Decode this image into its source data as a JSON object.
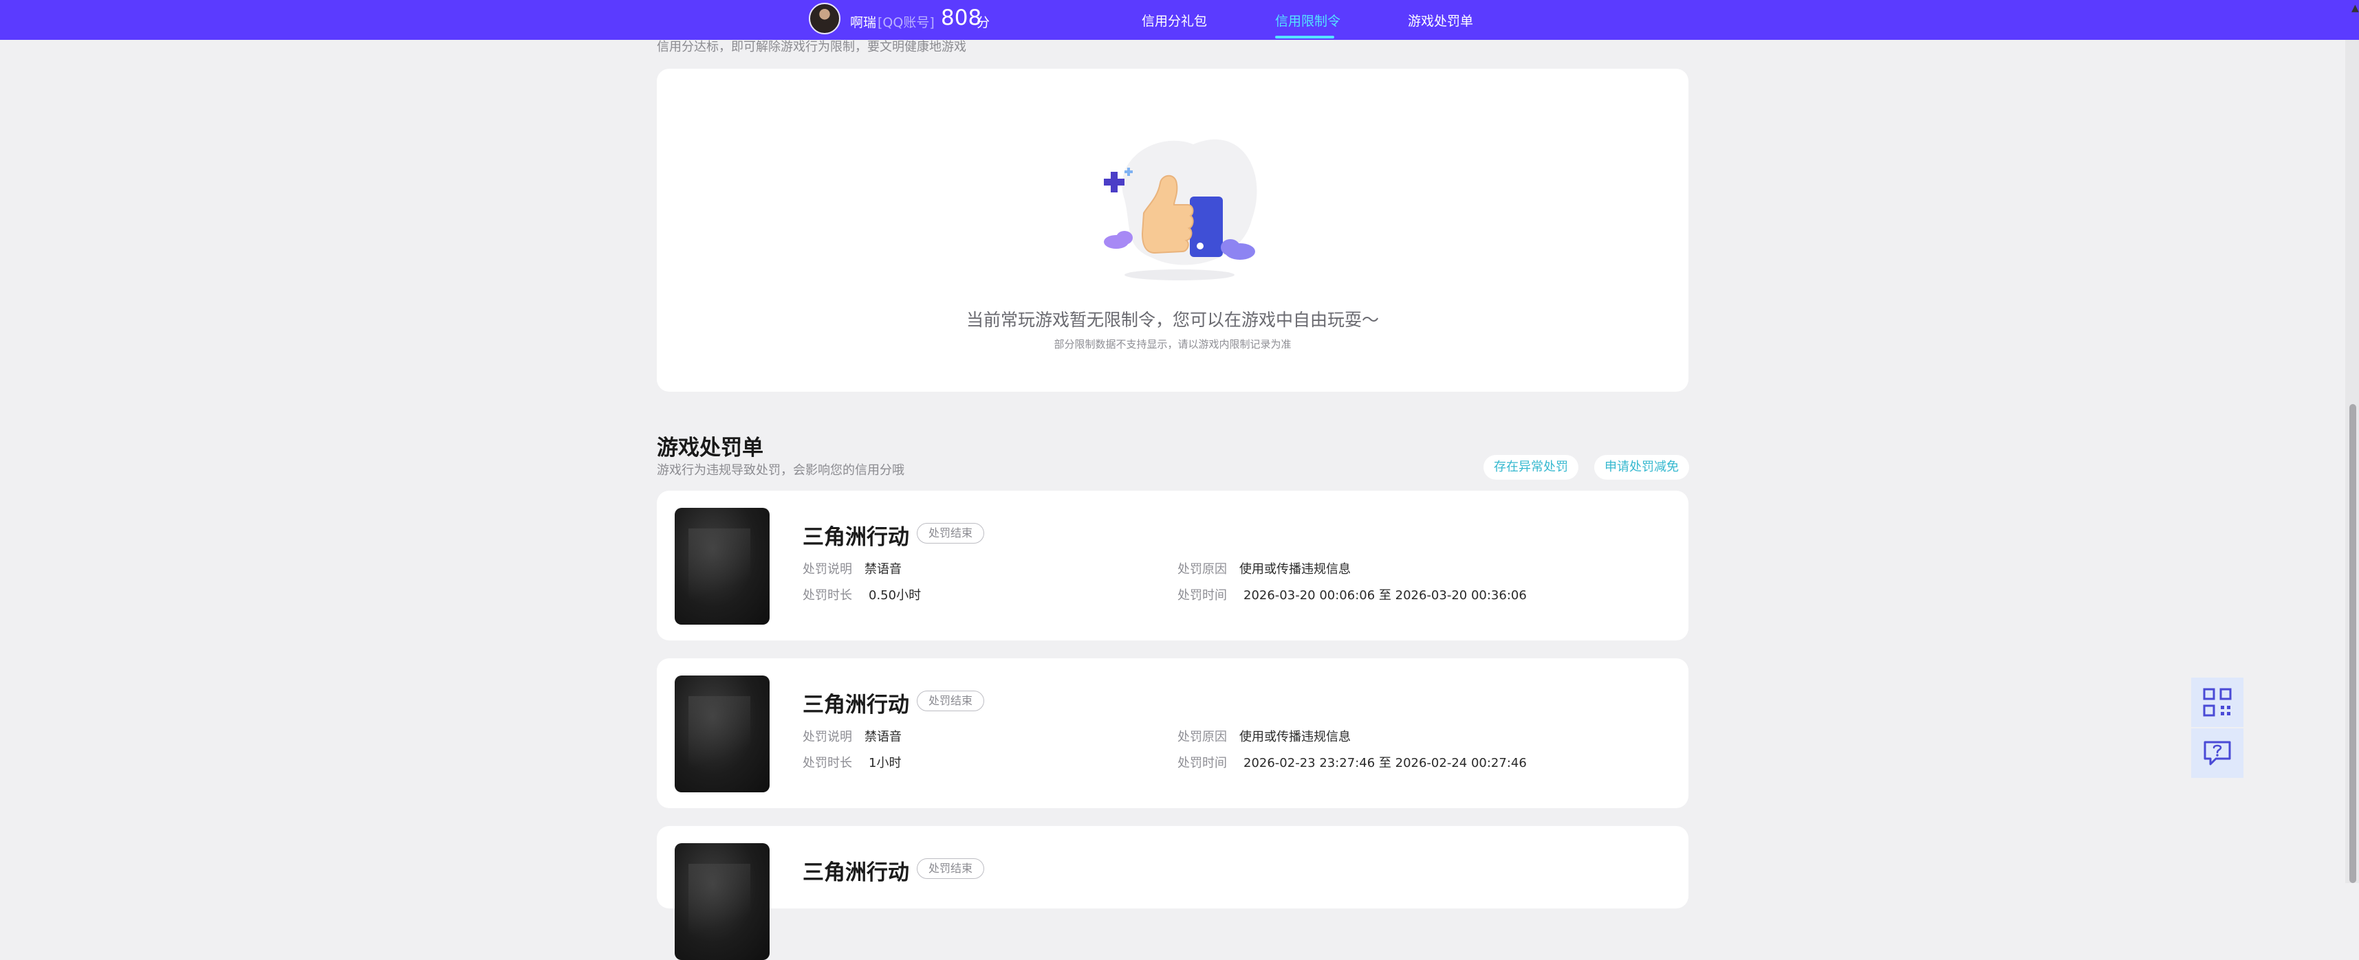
{
  "header": {
    "nickname": "啊瑞",
    "qq_label": "[QQ账号]",
    "score": "808",
    "score_unit": "分",
    "nav": [
      {
        "label": "信用分礼包",
        "active": false
      },
      {
        "label": "信用限制令",
        "active": true
      },
      {
        "label": "游戏处罚单",
        "active": false
      }
    ],
    "accent": "#5b3bff",
    "active_color": "#54e3ff"
  },
  "restriction": {
    "subtitle_cut": "信用分达标，即可解除游戏行为限制，要文明健康地游戏",
    "empty_title": "当前常玩游戏暂无限制令，您可以在游戏中自由玩耍～",
    "empty_note": "部分限制数据不支持显示，请以游戏内限制记录为准"
  },
  "penalties": {
    "title": "游戏处罚单",
    "subtitle": "游戏行为违规导致处罚，会影响您的信用分哦",
    "actions": [
      "存在异常处罚",
      "申请处罚减免"
    ],
    "labels": {
      "desc": "处罚说明",
      "duration": "处罚时长",
      "reason": "处罚原因",
      "time": "处罚时间"
    },
    "items": [
      {
        "game": "三角洲行动",
        "status": "处罚结束",
        "desc": "禁语音",
        "duration": "0.50小时",
        "reason": "使用或传播违规信息",
        "time": "2026-03-20 00:06:06 至 2026-03-20 00:36:06"
      },
      {
        "game": "三角洲行动",
        "status": "处罚结束",
        "desc": "禁语音",
        "duration": "1小时",
        "reason": "使用或传播违规信息",
        "time": "2026-02-23 23:27:46 至 2026-02-24 00:27:46"
      },
      {
        "game": "三角洲行动",
        "status": "处罚结束"
      }
    ]
  },
  "floating": {
    "icons": [
      "qr-code-icon",
      "help-chat-icon"
    ]
  }
}
